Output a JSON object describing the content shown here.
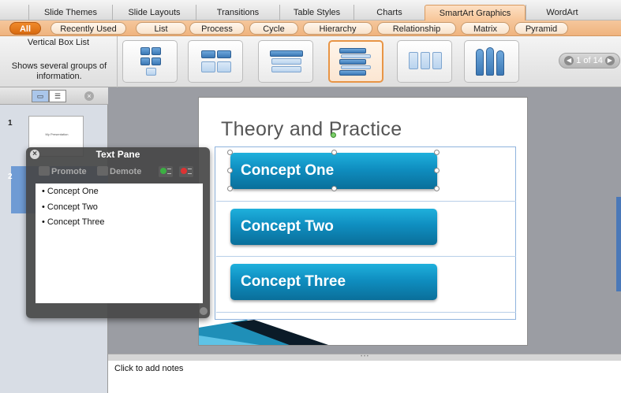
{
  "ribbon_tabs": [
    {
      "label": "Slide Themes",
      "active": false
    },
    {
      "label": "Slide Layouts",
      "active": false
    },
    {
      "label": "Transitions",
      "active": false
    },
    {
      "label": "Table Styles",
      "active": false
    },
    {
      "label": "Charts",
      "active": false
    },
    {
      "label": "SmartArt Graphics",
      "active": true
    },
    {
      "label": "WordArt",
      "active": false
    }
  ],
  "categories": [
    {
      "label": "All",
      "active": true
    },
    {
      "label": "Recently Used",
      "active": false
    },
    {
      "label": "List",
      "active": false
    },
    {
      "label": "Process",
      "active": false
    },
    {
      "label": "Cycle",
      "active": false
    },
    {
      "label": "Hierarchy",
      "active": false
    },
    {
      "label": "Relationship",
      "active": false
    },
    {
      "label": "Matrix",
      "active": false
    },
    {
      "label": "Pyramid",
      "active": false
    }
  ],
  "gallery": {
    "selected_name": "Vertical Box List",
    "selected_description": "Shows several groups of information.",
    "pager_label": "1 of 14",
    "prev_icon": "chevron-left-icon",
    "next_icon": "chevron-right-icon"
  },
  "sidebar": {
    "slides": [
      {
        "number": "1",
        "thumb_title": "My Presentation"
      },
      {
        "number": "2"
      }
    ]
  },
  "slide": {
    "title": "Theory and Practice",
    "concepts": [
      "Concept One",
      "Concept Two",
      "Concept Three"
    ]
  },
  "text_pane": {
    "title": "Text Pane",
    "promote_label": "Promote",
    "demote_label": "Demote",
    "bullets": [
      "Concept One",
      "Concept Two",
      "Concept Three"
    ]
  },
  "notes": {
    "placeholder": "Click to add notes"
  },
  "colors": {
    "accent_orange": "#e8893a",
    "concept_blue": "#0f8ec0",
    "selection_blue": "#6f9bd4"
  }
}
